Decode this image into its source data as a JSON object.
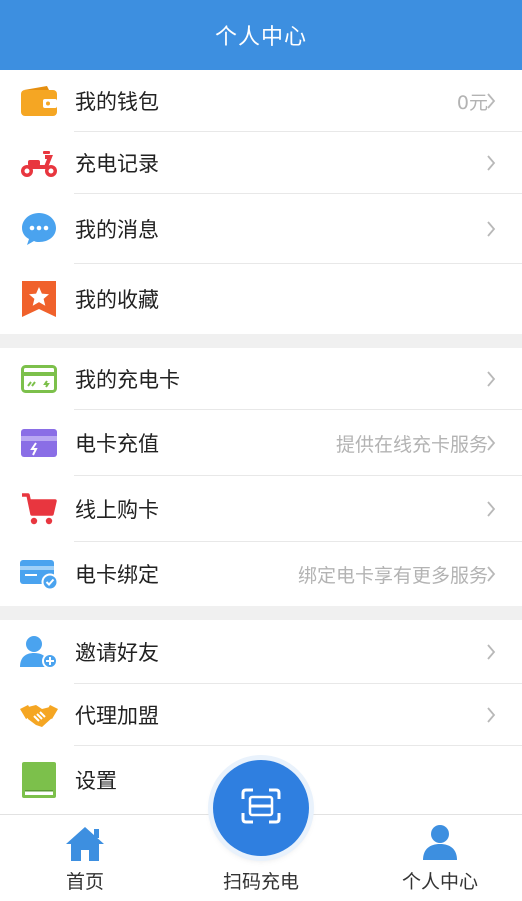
{
  "header": {
    "title": "个人中心"
  },
  "groups": [
    {
      "items": [
        {
          "label": "我的钱包",
          "right": "0元",
          "icon": "wallet-icon"
        },
        {
          "label": "充电记录",
          "right": "",
          "icon": "scooter-icon"
        },
        {
          "label": "我的消息",
          "right": "",
          "icon": "message-icon"
        },
        {
          "label": "我的收藏",
          "right": "",
          "icon": "star-bookmark-icon"
        }
      ]
    },
    {
      "items": [
        {
          "label": "我的充电卡",
          "right": "",
          "icon": "charge-card-icon"
        },
        {
          "label": "电卡充值",
          "right": "提供在线充卡服务",
          "icon": "card-recharge-icon"
        },
        {
          "label": "线上购卡",
          "right": "",
          "icon": "shopping-cart-icon"
        },
        {
          "label": "电卡绑定",
          "right": "绑定电卡享有更多服务",
          "icon": "card-bind-icon"
        }
      ]
    },
    {
      "items": [
        {
          "label": "邀请好友",
          "right": "",
          "icon": "invite-friend-icon"
        },
        {
          "label": "代理加盟",
          "right": "",
          "icon": "handshake-icon"
        },
        {
          "label": "设置",
          "right": "",
          "icon": "settings-book-icon"
        }
      ]
    }
  ],
  "tabbar": {
    "home": "首页",
    "scan": "扫码充电",
    "profile": "个人中心"
  },
  "colors": {
    "header": "#3d8fe0",
    "accent": "#2f7fe0",
    "wallet": "#f5a623",
    "red": "#e8363f",
    "message": "#4aa3ef",
    "bookmark": "#f0612b",
    "card_green": "#7cc04b",
    "card_purple": "#8a6ee6"
  }
}
